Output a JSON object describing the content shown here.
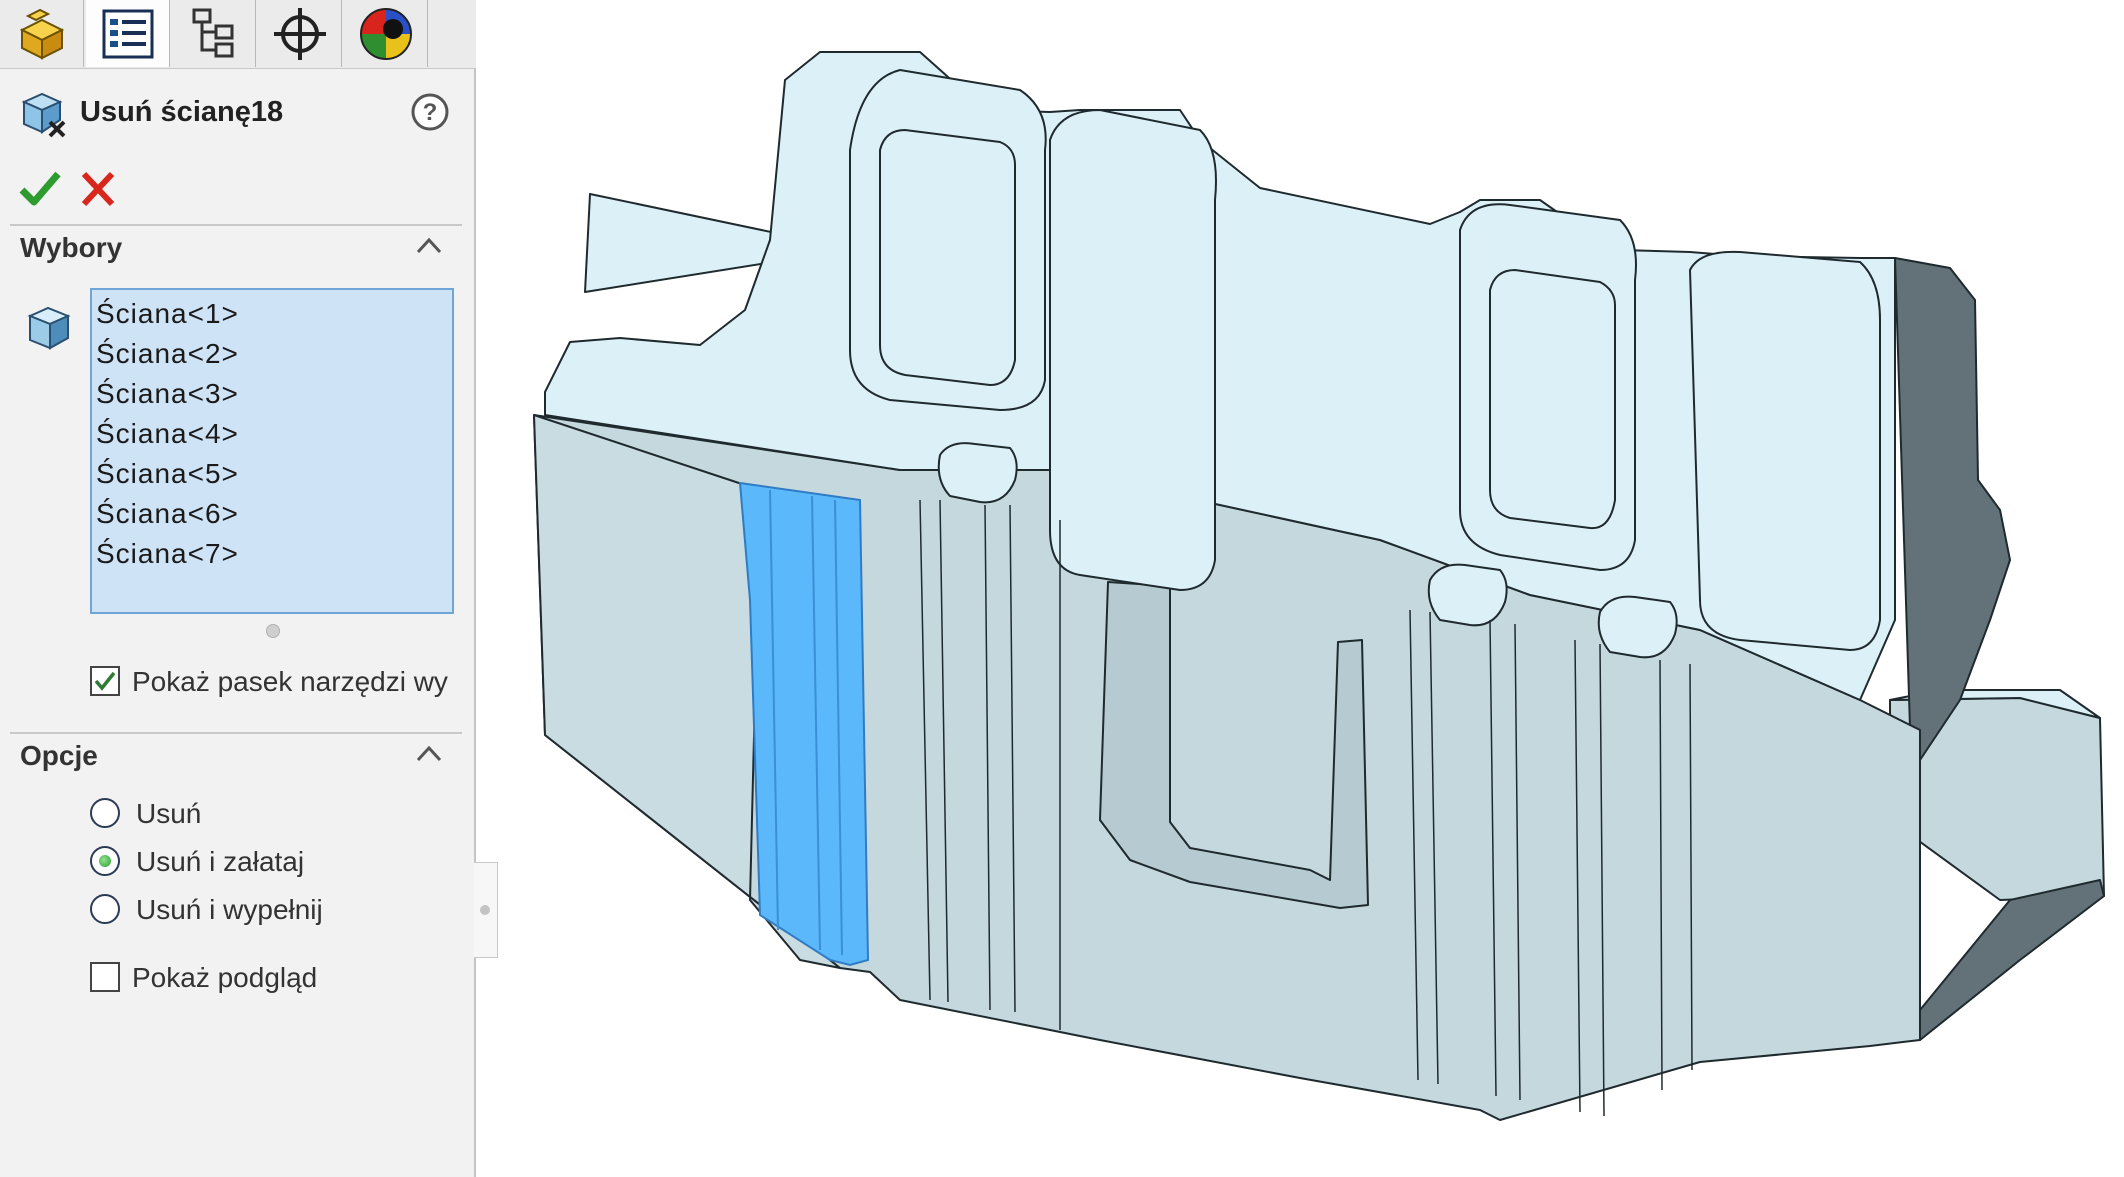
{
  "tabs": [
    {
      "name": "feature-manager",
      "icon": "part-icon"
    },
    {
      "name": "property-manager",
      "icon": "list-icon"
    },
    {
      "name": "configuration-manager",
      "icon": "configuration-icon"
    },
    {
      "name": "dimxpert-manager",
      "icon": "crosshair-icon"
    },
    {
      "name": "display-manager",
      "icon": "appearance-sphere-icon"
    }
  ],
  "property_manager": {
    "title": "Usuń ścianę18",
    "title_icon": "delete-face-icon",
    "help_icon": "help-icon",
    "ok_icon": "checkmark-icon",
    "cancel_icon": "close-icon",
    "ok_color": "#2e9b2e",
    "cancel_color": "#d9261c"
  },
  "selections_group": {
    "title": "Wybory",
    "selection_icon": "face-icon",
    "items": [
      "Ściana<1>",
      "Ściana<2>",
      "Ściana<3>",
      "Ściana<4>",
      "Ściana<5>",
      "Ściana<6>",
      "Ściana<7>"
    ],
    "show_toolbar": {
      "label": "Pokaż pasek narzędzi wy",
      "checked": true
    }
  },
  "options_group": {
    "title": "Opcje",
    "options": [
      {
        "label": "Usuń",
        "selected": false
      },
      {
        "label": "Usuń i załataj",
        "selected": true
      },
      {
        "label": "Usuń i wypełnij",
        "selected": false
      }
    ],
    "preview": {
      "label": "Pokaż podgląd",
      "checked": false
    }
  },
  "colors": {
    "model_face": "#dcf0f8",
    "model_side": "#c4d8de",
    "model_dark": "#627278",
    "selected_face": "#5bb8fa"
  }
}
